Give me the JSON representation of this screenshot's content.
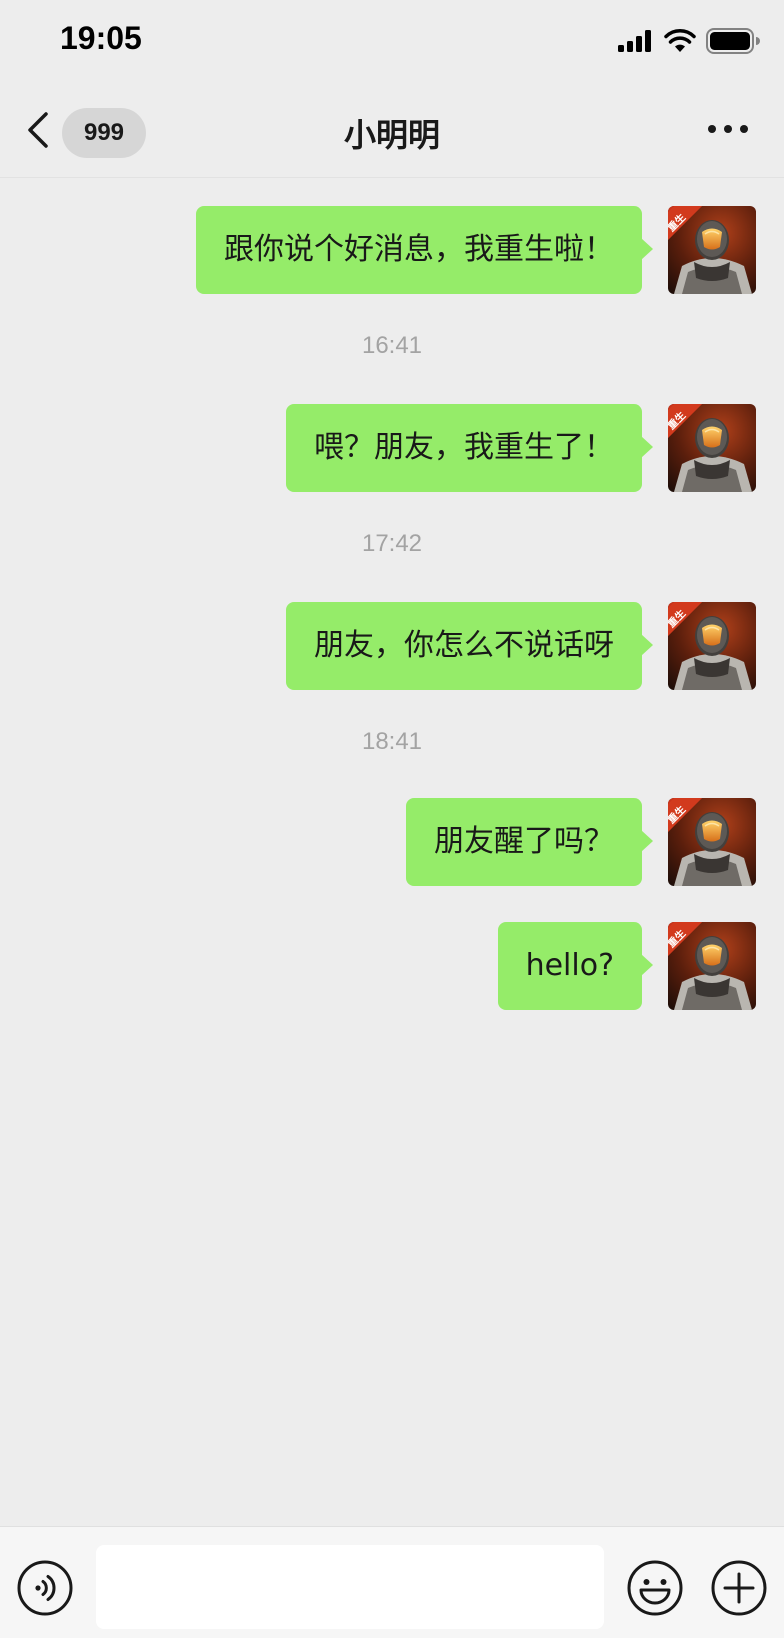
{
  "status_bar": {
    "time": "19:05"
  },
  "nav": {
    "unread_count": "999",
    "title": "小明明"
  },
  "messages": [
    {
      "type": "message",
      "text": "跟你说个好消息，我重生啦！"
    },
    {
      "type": "timestamp",
      "text": "16:41"
    },
    {
      "type": "message",
      "text": "喂？朋友，我重生了！"
    },
    {
      "type": "timestamp",
      "text": "17:42"
    },
    {
      "type": "message",
      "text": "朋友，你怎么不说话呀"
    },
    {
      "type": "timestamp",
      "text": "18:41"
    },
    {
      "type": "message",
      "text": "朋友醒了吗？"
    },
    {
      "type": "message",
      "text": "hello?"
    }
  ],
  "avatar": {
    "badge_text": "重生",
    "icon": "armored-soldier-avatar"
  },
  "input": {
    "value": "",
    "placeholder": ""
  },
  "colors": {
    "bubble": "#95ec69",
    "background": "#ededed",
    "badge": "#d6d6d6"
  }
}
